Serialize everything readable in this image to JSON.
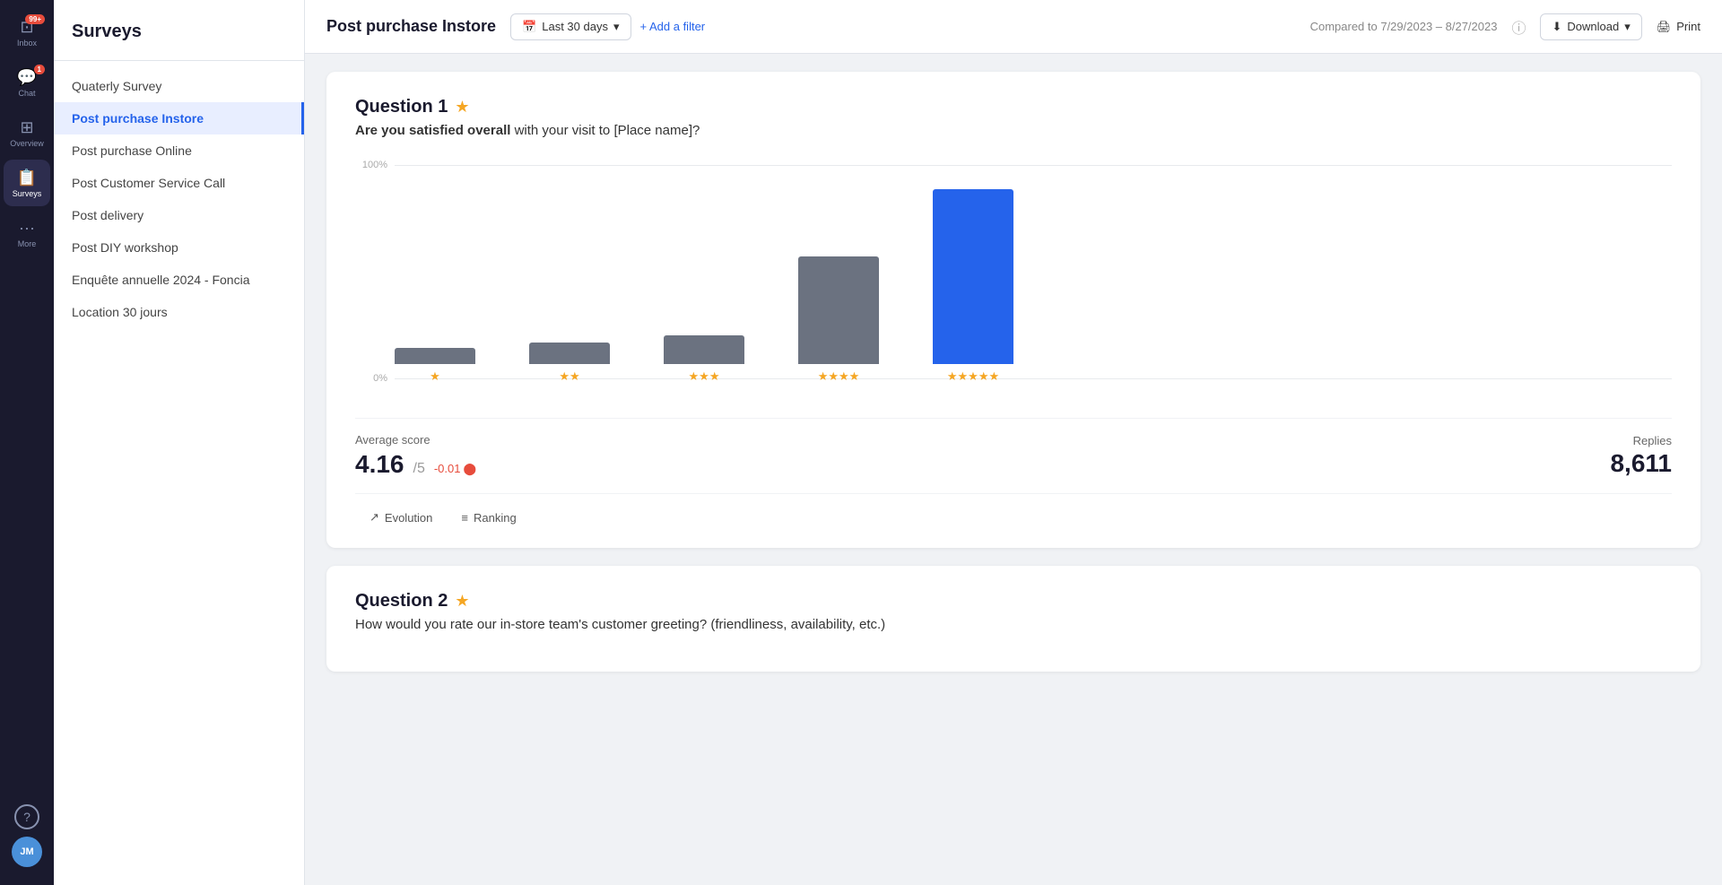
{
  "iconNav": {
    "items": [
      {
        "id": "inbox",
        "icon": "⊡",
        "label": "Inbox",
        "badge": "99+",
        "active": false
      },
      {
        "id": "chat",
        "icon": "💬",
        "label": "Chat",
        "badge": "1",
        "active": false
      },
      {
        "id": "overview",
        "icon": "⊞",
        "label": "Overview",
        "badge": null,
        "active": false
      },
      {
        "id": "surveys",
        "icon": "📋",
        "label": "Surveys",
        "badge": null,
        "active": true
      },
      {
        "id": "more",
        "icon": "⋯",
        "label": "More",
        "badge": null,
        "active": false
      }
    ],
    "helpLabel": "?",
    "avatarLabel": "JM"
  },
  "sidebar": {
    "title": "Surveys",
    "items": [
      {
        "id": "quarterly",
        "label": "Quaterly Survey",
        "active": false
      },
      {
        "id": "post-purchase-instore",
        "label": "Post purchase Instore",
        "active": true
      },
      {
        "id": "post-purchase-online",
        "label": "Post purchase Online",
        "active": false
      },
      {
        "id": "post-customer-service",
        "label": "Post Customer Service Call",
        "active": false
      },
      {
        "id": "post-delivery",
        "label": "Post delivery",
        "active": false
      },
      {
        "id": "post-diy",
        "label": "Post DIY workshop",
        "active": false
      },
      {
        "id": "enquete-annuelle",
        "label": "Enquête annuelle 2024 - Foncia",
        "active": false
      },
      {
        "id": "location-30",
        "label": "Location 30 jours",
        "active": false
      }
    ]
  },
  "header": {
    "title": "Post purchase Instore",
    "dateFilter": "Last 30 days",
    "addFilterLabel": "+ Add a filter",
    "comparisonText": "Compared to 7/29/2023 – 8/27/2023",
    "downloadLabel": "Download",
    "printLabel": "Print"
  },
  "question1": {
    "number": "Question 1",
    "starCount": "★",
    "questionText": "Are you satisfied overall",
    "questionTextSuffix": " with your visit to [Place name]?",
    "gridlineTop": "100%",
    "gridlineBottom": "0%",
    "bars": [
      {
        "stars": "★",
        "heightPx": 18,
        "color": "#6b7280"
      },
      {
        "stars": "★★",
        "heightPx": 24,
        "color": "#6b7280"
      },
      {
        "stars": "★★★",
        "heightPx": 32,
        "color": "#6b7280"
      },
      {
        "stars": "★★★★",
        "heightPx": 120,
        "color": "#6b7280"
      },
      {
        "stars": "★★★★★",
        "heightPx": 195,
        "color": "#2563eb"
      }
    ],
    "avgLabel": "Average score",
    "avgValue": "4.16",
    "avgDenom": "/5",
    "avgChange": "-0.01",
    "avgChangeIcon": "↓",
    "repliesLabel": "Replies",
    "repliesValue": "8,611",
    "tabs": [
      {
        "id": "evolution",
        "icon": "↗",
        "label": "Evolution"
      },
      {
        "id": "ranking",
        "icon": "≡",
        "label": "Ranking"
      }
    ]
  },
  "question2": {
    "number": "Question 2",
    "starCount": "★",
    "questionText": "How would you rate our in-store team's customer greeting? (friendliness, availability, etc.)"
  }
}
